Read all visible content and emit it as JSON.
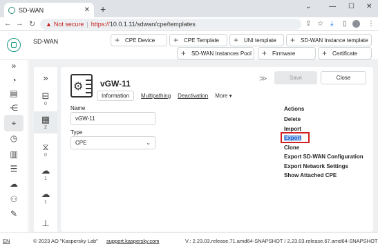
{
  "browser": {
    "tab_title": "SD-WAN",
    "not_secure": "Not secure",
    "url_scheme": "https://",
    "url_rest": "10.0.1.11/sdwan/cpe/templates"
  },
  "header": {
    "title": "SD-WAN",
    "buttons": [
      "CPE Device",
      "CPE Template",
      "UNI template",
      "SD-WAN Instance template",
      "SD-WAN Instances Pool",
      "Firmware",
      "Certificate"
    ]
  },
  "rail": {
    "items": [
      "expand-icon",
      "dashboard-icon",
      "document-icon",
      "share-icon",
      "location-pin-icon",
      "clock-icon",
      "chart-icon",
      "list-icon",
      "cloud-icon",
      "users-icon",
      "wrench-icon"
    ]
  },
  "subcol": {
    "counts": [
      "0",
      "2",
      "0",
      "1",
      "1"
    ]
  },
  "card": {
    "title": "vGW-11",
    "tabs": [
      "Information",
      "Multipathing",
      "Deactivation",
      "More ▾"
    ],
    "save": "Save",
    "close": "Close",
    "name_label": "Name",
    "name_value": "vGW-11",
    "type_label": "Type",
    "type_value": "CPE",
    "actions_title": "Actions",
    "actions": [
      "Delete",
      "Import",
      "Export",
      "Clone",
      "Export SD-WAN Configuration",
      "Export Network Settings",
      "Show Attached CPE"
    ]
  },
  "footer": {
    "lang": "EN",
    "copyright": "© 2023 AO \"Kaspersky Lab\"",
    "link": "support.kaspersky.com",
    "version": "V.: 2.23.03.release.71.amd64-SNAPSHOT / 2.23.03.release.67.amd64-SNAPSHOT"
  },
  "colors": {
    "accent": "#1d9a86",
    "highlight": "#d21f1f"
  }
}
